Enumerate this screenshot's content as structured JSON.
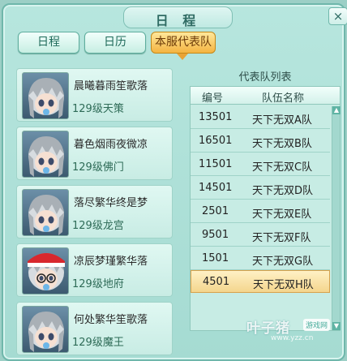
{
  "window": {
    "title": "日 程",
    "close_label": "×"
  },
  "tabs": [
    {
      "label": "日程"
    },
    {
      "label": "日历"
    },
    {
      "label": "本服代表队"
    }
  ],
  "characters": [
    {
      "name": "晨曦暮雨笙歌落",
      "level": "129级天策"
    },
    {
      "name": "暮色烟雨夜微凉",
      "level": "129级佛门"
    },
    {
      "name": "落尽繁华终是梦",
      "level": "129级龙宫"
    },
    {
      "name": "凉辰梦瑾繁华落",
      "level": "129级地府"
    },
    {
      "name": "何处繁华笙歌落",
      "level": "129级魔王"
    }
  ],
  "team_list": {
    "title": "代表队列表",
    "columns": [
      "编号",
      "队伍名称"
    ],
    "rows": [
      {
        "id": "13501",
        "name": "天下无双A队"
      },
      {
        "id": "16501",
        "name": "天下无双B队"
      },
      {
        "id": "11501",
        "name": "天下无双C队"
      },
      {
        "id": "14501",
        "name": "天下无双D队"
      },
      {
        "id": "2501",
        "name": "天下无双E队"
      },
      {
        "id": "9501",
        "name": "天下无双F队"
      },
      {
        "id": "1501",
        "name": "天下无双G队"
      },
      {
        "id": "4501",
        "name": "天下无双H队"
      }
    ],
    "selected_row": 7
  },
  "watermark": {
    "main": "叶子猪",
    "badge": "游戏网",
    "url": "www.yzz.cn"
  },
  "colors": {
    "accent": "#f4b441",
    "panel": "#b7e6de",
    "selected": "#f4d58d"
  }
}
